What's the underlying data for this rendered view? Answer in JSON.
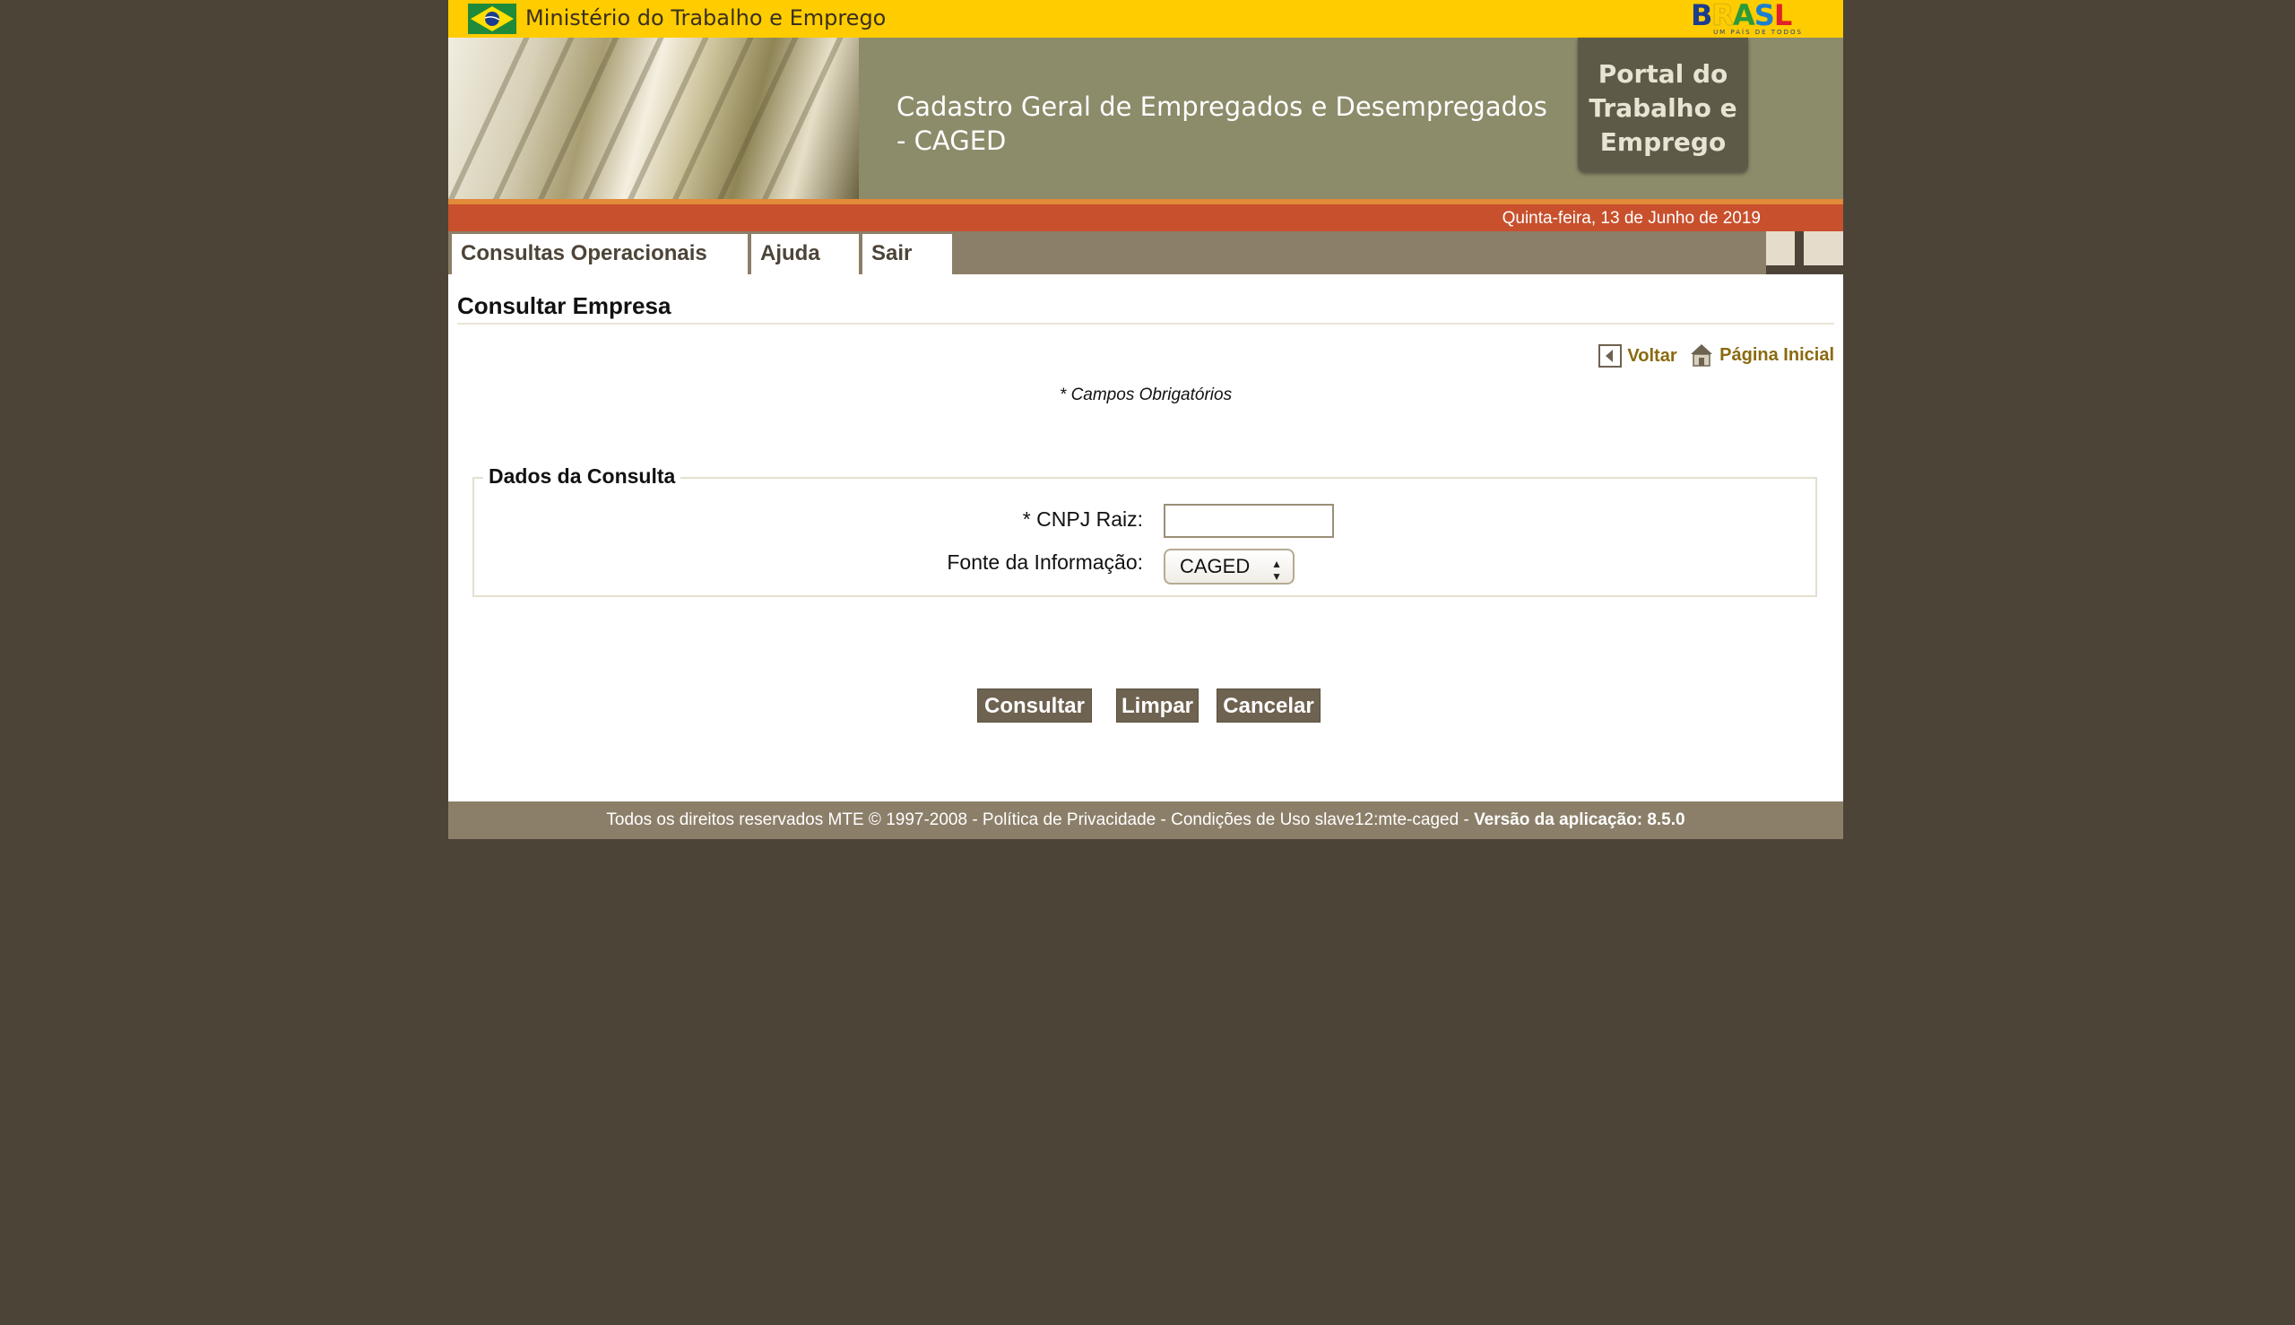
{
  "header": {
    "ministry": "Ministério do Trabalho e Emprego",
    "brasil_tagline": "UM PAÍS DE TODOS",
    "system_title": "Cadastro Geral de Empregados e Desempregados - CAGED",
    "portal_label": "Portal do\nTrabalho e\nEmprego",
    "date": "Quinta-feira, 13 de Junho de 2019"
  },
  "menu": {
    "items": [
      {
        "label": "Consultas Operacionais"
      },
      {
        "label": "Ajuda"
      },
      {
        "label": "Sair"
      }
    ]
  },
  "content": {
    "title": "Consultar Empresa",
    "back_link": "Voltar",
    "home_link": "Página Inicial",
    "required_note": "* Campos Obrigatórios",
    "fieldset_legend": "Dados da Consulta",
    "cnpj_label": "* CNPJ Raiz:",
    "cnpj_value": "",
    "fonte_label": "Fonte da Informação:",
    "fonte_selected": "CAGED"
  },
  "buttons": {
    "consultar": "Consultar",
    "limpar": "Limpar",
    "cancelar": "Cancelar"
  },
  "footer": {
    "text": "Todos os direitos reservados MTE © 1997-2008 - Política de Privacidade - Condições de Uso slave12:mte-caged - ",
    "version": "Versão da aplicação: 8.5.0"
  },
  "colors": {
    "gov_bar": "#ffcc00",
    "banner": "#8c8b6a",
    "date_bar": "#c8502c",
    "menu_bar": "#8c7f69",
    "button": "#6e6250",
    "link": "#8a6a10",
    "background": "#4d4438"
  }
}
